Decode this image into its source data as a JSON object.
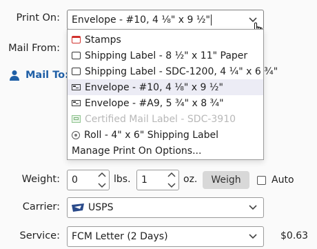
{
  "print_on": {
    "label": "Print On:",
    "value": "Envelope - #10, 4 ⅛\" x 9 ½\"",
    "options": [
      {
        "label": "Stamps",
        "icon": "stamp-icon",
        "selected": false,
        "disabled": false
      },
      {
        "label": "Shipping Label - 8 ½\" x 11\" Paper",
        "icon": "label-sheet-icon",
        "selected": false,
        "disabled": false
      },
      {
        "label": "Shipping Label - SDC-1200, 4 ¼\" x 6 ¾\"",
        "icon": "label-sheet-icon",
        "selected": false,
        "disabled": false
      },
      {
        "label": "Envelope - #10, 4 ⅛\" x 9 ½\"",
        "icon": "envelope-icon",
        "selected": true,
        "disabled": false
      },
      {
        "label": "Envelope - #A9, 5 ¾\" x 8 ¾\"",
        "icon": "envelope-icon",
        "selected": false,
        "disabled": false
      },
      {
        "label": "Certified Mail Label - SDC-3910",
        "icon": "certified-mail-icon",
        "selected": false,
        "disabled": true
      },
      {
        "label": "Roll - 4\" x 6\" Shipping Label",
        "icon": "roll-icon",
        "selected": false,
        "disabled": false
      }
    ],
    "manage_label": "Manage Print On Options..."
  },
  "mail_from": {
    "label": "Mail From:"
  },
  "mail_to": {
    "label": "Mail To:"
  },
  "weight": {
    "label": "Weight:",
    "lbs_value": "0",
    "lbs_unit": "lbs.",
    "oz_value": "1",
    "oz_unit": "oz.",
    "weigh_button": "Weigh",
    "auto_label": "Auto",
    "auto_checked": false
  },
  "carrier": {
    "label": "Carrier:",
    "value": "USPS",
    "logo": "usps-eagle-icon"
  },
  "service": {
    "label": "Service:",
    "value": "FCM Letter (2 Days)",
    "price": "$0.63"
  },
  "colors": {
    "accent": "#1f5fa6",
    "selected_row": "#ececf5",
    "disabled_text": "#b8b8b8",
    "usps_blue": "#2a4a8a",
    "stamp_red": "#d0312d"
  }
}
